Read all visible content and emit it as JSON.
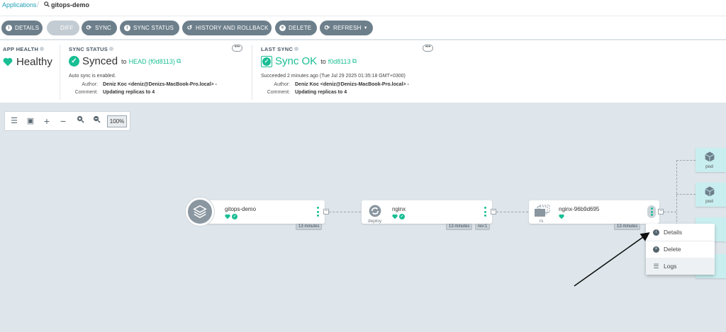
{
  "breadcrumb": {
    "parent": "Applications",
    "current": "gitops-demo"
  },
  "toolbar": {
    "details": "DETAILS",
    "diff": "DIFF",
    "sync": "SYNC",
    "sync_status": "SYNC STATUS",
    "history": "HISTORY AND ROLLBACK",
    "delete": "DELETE",
    "refresh": "REFRESH"
  },
  "app_health": {
    "title": "APP HEALTH",
    "value": "Healthy"
  },
  "sync_status": {
    "title": "SYNC STATUS",
    "value": "Synced",
    "to": "to",
    "revision": "HEAD (f0d8113)",
    "auto_sync": "Auto sync is enabled.",
    "author_label": "Author:",
    "author": "Deniz Koc <deniz@Denizs-MacBook-Pro.local> -",
    "comment_label": "Comment:",
    "comment": "Updating replicas to 4"
  },
  "last_sync": {
    "title": "LAST SYNC",
    "value": "Sync OK",
    "to": "to",
    "revision": "f0d8113",
    "succeeded": "Succeeded 2 minutes ago (Tue Jul 29 2025 01:35:18 GMT+0300)",
    "author_label": "Author:",
    "author": "Deniz Koc <deniz@Denizs-MacBook-Pro.local> -",
    "comment_label": "Comment:",
    "comment": "Updating replicas to 4"
  },
  "more_label": "•••",
  "graph_tools": {
    "zoom": "100%"
  },
  "nodes": {
    "app": {
      "name": "gitops-demo",
      "age": "13 minutes"
    },
    "deploy": {
      "name": "nginx",
      "kind": "deploy",
      "age": "13 minutes",
      "rev": "rev:1"
    },
    "rs": {
      "name": "nginx-96b9d695",
      "kind": "rs",
      "age": "13 minutes"
    },
    "pods": [
      "pod",
      "pod"
    ]
  },
  "context_menu": {
    "details": "Details",
    "delete": "Delete",
    "logs": "Logs"
  },
  "colors": {
    "accent": "#18be94",
    "button": "#6d7f8b",
    "link": "#1f9fb5",
    "pod_bg": "#c9eef0",
    "canvas": "#dee6eb"
  },
  "icons": [
    "search-icon",
    "info-icon",
    "file-icon",
    "sync-icon",
    "history-icon",
    "delete-icon",
    "refresh-icon",
    "heart-icon",
    "check-icon",
    "external-link-icon",
    "layers-icon",
    "cube-icon"
  ]
}
